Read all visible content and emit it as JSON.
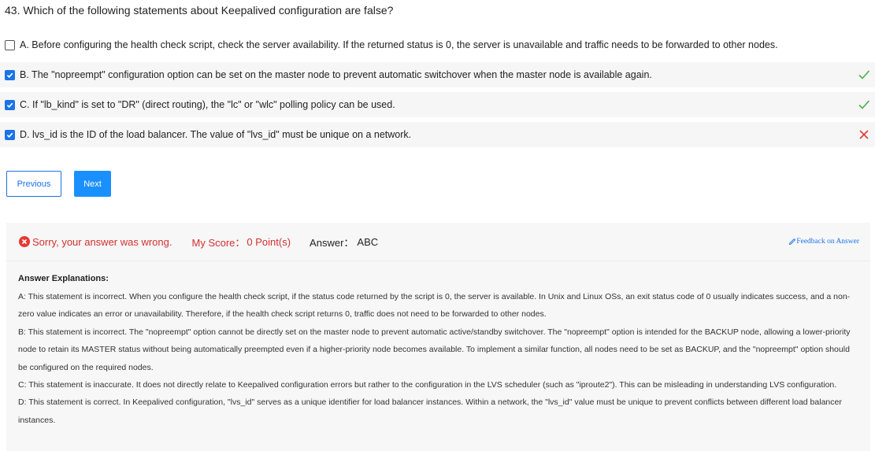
{
  "question": {
    "text": "43. Which of the following statements about Keepalived configuration are false?"
  },
  "options": [
    {
      "text": "A. Before configuring the health check script, check the server availability. If the returned status is 0, the server is unavailable and traffic needs to be forwarded to other nodes.",
      "checked": false,
      "mark": ""
    },
    {
      "text": "B. The \"nopreempt\" configuration option can be set on the master node to prevent automatic switchover when the master node is available again.",
      "checked": true,
      "mark": "correct"
    },
    {
      "text": "C. If \"lb_kind\" is set to \"DR\" (direct routing), the \"lc\" or \"wlc\" polling policy can be used.",
      "checked": true,
      "mark": "correct"
    },
    {
      "text": "D. lvs_id is the ID of the load balancer. The value of \"lvs_id\" must be unique on a network.",
      "checked": true,
      "mark": "wrong"
    }
  ],
  "buttons": {
    "previous": "Previous",
    "next": "Next"
  },
  "result": {
    "message": "Sorry, your answer was wrong.",
    "score_label": "My Score：",
    "score_value": "0 Point(s)",
    "answer_label": "Answer：",
    "answer_value": "ABC",
    "feedback": "Feedback on Answer"
  },
  "explanations": {
    "title": "Answer Explanations:",
    "items": [
      "A: This statement is incorrect. When you configure the health check script, if the status code returned by the script is 0, the server is available. In Unix and Linux OSs, an exit status code of 0 usually indicates success, and a non-zero value indicates an error or unavailability. Therefore, if the health check script returns 0, traffic does not need to be forwarded to other nodes.",
      "B: This statement is incorrect. The \"nopreempt\" option cannot be directly set on the master node to prevent automatic active/standby switchover. The \"nopreempt\" option is intended for the BACKUP node, allowing a lower-priority node to retain its MASTER status without being automatically preempted even if a higher-priority node becomes available. To implement a similar function, all nodes need to be set as BACKUP, and the \"nopreempt\" option should be configured on the required nodes.",
      "C: This statement is inaccurate. It does not directly relate to Keepalived configuration errors but rather to the configuration in the LVS scheduler (such as \"iproute2\"). This can be misleading in understanding LVS configuration.",
      "D: This statement is correct. In Keepalived configuration, \"lvs_id\" serves as a unique identifier for load balancer instances. Within a network, the \"lvs_id\" value must be unique to prevent conflicts between different load balancer instances."
    ]
  },
  "colors": {
    "accent": "#1a73e8",
    "correct": "#4caf50",
    "wrong": "#e53935"
  }
}
